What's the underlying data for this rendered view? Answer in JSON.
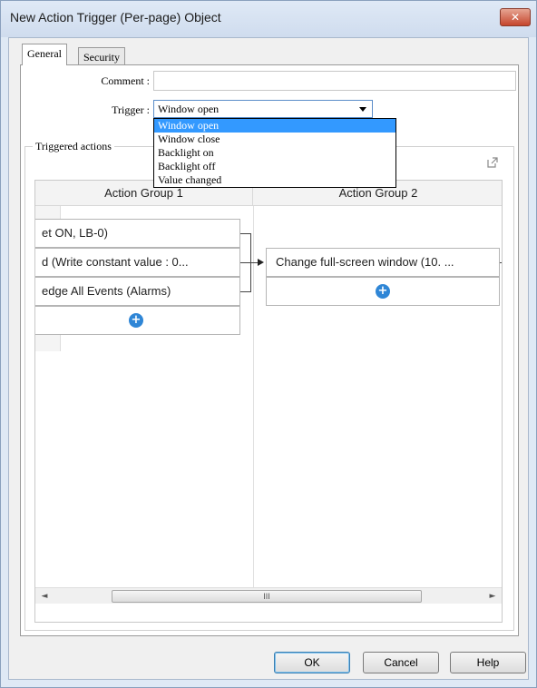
{
  "window": {
    "title": "New Action Trigger (Per-page) Object",
    "close_glyph": "✕"
  },
  "tabs": [
    {
      "label": "General",
      "active": true
    },
    {
      "label": "Security",
      "active": false
    }
  ],
  "form": {
    "comment_label": "Comment :",
    "comment_value": "",
    "trigger_label": "Trigger :",
    "trigger_value": "Window open",
    "trigger_options": [
      "Window open",
      "Window close",
      "Backlight on",
      "Backlight off",
      "Value changed"
    ]
  },
  "triggered_actions": {
    "label": "Triggered actions",
    "popout_icon": "external-link-icon",
    "group_headers": [
      "Action Group 1",
      "Action Group 2"
    ],
    "group1_actions": [
      "et ON, LB-0)",
      "d (Write constant value : 0...",
      "edge All Events (Alarms)"
    ],
    "group2_actions": [
      "Change full-screen window (10. ..."
    ],
    "add_glyph": "+",
    "scrollbar": {
      "left": "◄",
      "right": "►",
      "grip": "III"
    }
  },
  "buttons": {
    "ok": "OK",
    "cancel": "Cancel",
    "help": "Help"
  }
}
